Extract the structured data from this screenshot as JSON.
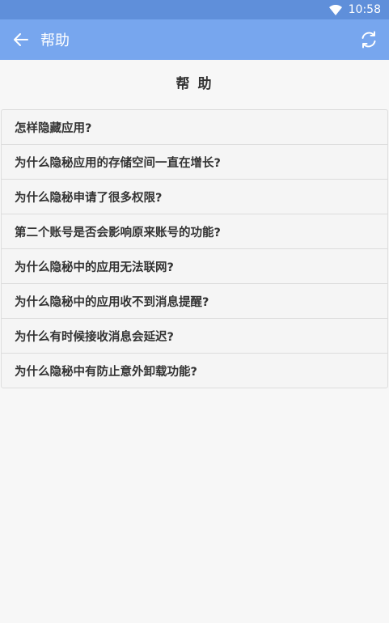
{
  "status_bar": {
    "time": "10:58",
    "wifi_icon": "wifi-icon"
  },
  "app_bar": {
    "title": "帮助",
    "back_icon": "arrow-left-icon",
    "refresh_icon": "refresh-icon",
    "background": "#77a6ee"
  },
  "heading": "帮 助",
  "faq": [
    {
      "question": "怎样隐藏应用?"
    },
    {
      "question": "为什么隐秘应用的存储空间一直在增长?"
    },
    {
      "question": "为什么隐秘申请了很多权限?"
    },
    {
      "question": "第二个账号是否会影响原来账号的功能?"
    },
    {
      "question": "为什么隐秘中的应用无法联网?"
    },
    {
      "question": "为什么隐秘中的应用收不到消息提醒?"
    },
    {
      "question": "为什么有时候接收消息会延迟?"
    },
    {
      "question": "为什么隐秘中有防止意外卸载功能?"
    }
  ]
}
